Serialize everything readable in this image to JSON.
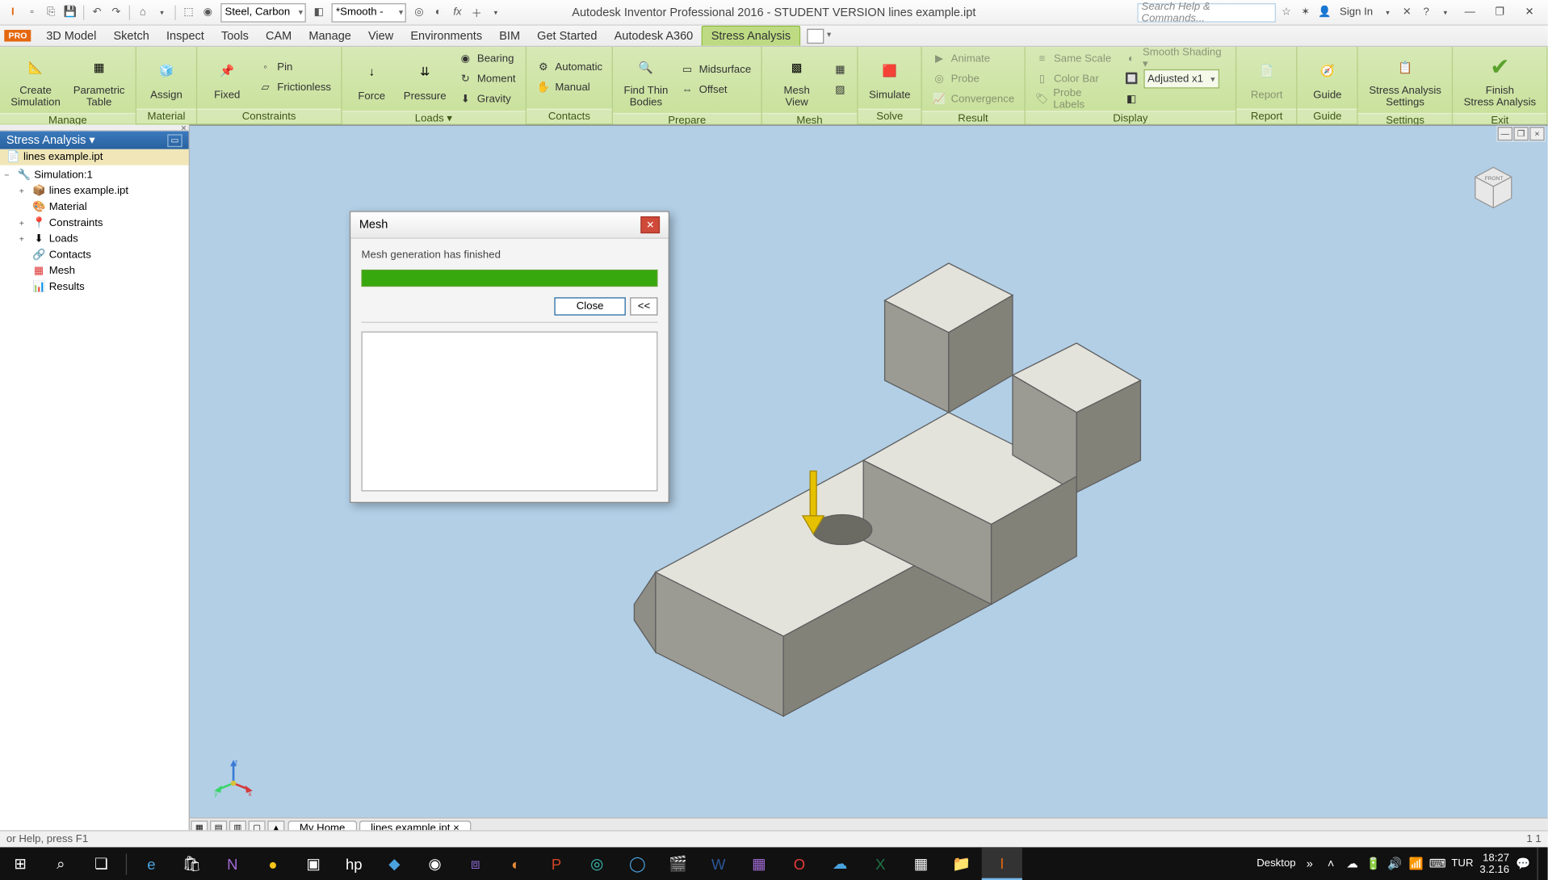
{
  "title": "Autodesk Inventor Professional 2016 - STUDENT VERSION   lines example.ipt",
  "search_placeholder": "Search Help & Commands...",
  "sign_in": "Sign In",
  "material": "Steel, Carbon",
  "appearance": "*Smooth -",
  "pro": "PRO",
  "tabs": [
    "3D Model",
    "Sketch",
    "Inspect",
    "Tools",
    "CAM",
    "Manage",
    "View",
    "Environments",
    "BIM",
    "Get Started",
    "Autodesk A360",
    "Stress Analysis"
  ],
  "ribbon": {
    "manage": {
      "label": "Manage",
      "create": "Create\nSimulation",
      "table": "Parametric\nTable",
      "assign": "Assign"
    },
    "material": {
      "label": "Material"
    },
    "constraints": {
      "label": "Constraints",
      "fixed": "Fixed",
      "pin": "Pin",
      "frictionless": "Frictionless"
    },
    "loads": {
      "label": "Loads ▾",
      "force": "Force",
      "pressure": "Pressure",
      "bearing": "Bearing",
      "moment": "Moment",
      "gravity": "Gravity"
    },
    "contacts": {
      "label": "Contacts",
      "auto": "Automatic",
      "manual": "Manual"
    },
    "prepare": {
      "label": "Prepare",
      "find": "Find Thin\nBodies",
      "mid": "Midsurface",
      "offset": "Offset"
    },
    "mesh": {
      "label": "Mesh",
      "view": "Mesh View"
    },
    "solve": {
      "label": "Solve",
      "sim": "Simulate"
    },
    "result": {
      "label": "Result",
      "animate": "Animate",
      "probe": "Probe",
      "convergence": "Convergence"
    },
    "display": {
      "label": "Display",
      "samescale": "Same Scale",
      "colorbar": "Color Bar",
      "probelabels": "Probe Labels",
      "shading": "Smooth Shading ▾",
      "adjusted": "Adjusted x1"
    },
    "report": {
      "label": "Report",
      "btn": "Report"
    },
    "guide": {
      "label": "Guide",
      "btn": "Guide"
    },
    "settings": {
      "label": "Settings",
      "btn": "Stress Analysis\nSettings"
    },
    "exit": {
      "label": "Exit",
      "btn": "Finish\nStress Analysis"
    }
  },
  "browser": {
    "header": "Stress Analysis ▾",
    "file": "lines example.ipt",
    "sim": "Simulation:1",
    "part": "lines example.ipt",
    "material": "Material",
    "constraints": "Constraints",
    "loads": "Loads",
    "contacts": "Contacts",
    "mesh": "Mesh",
    "results": "Results"
  },
  "dialog": {
    "title": "Mesh",
    "msg": "Mesh generation has finished",
    "close": "Close",
    "expand": "<<"
  },
  "doctabs": {
    "home": "My Home",
    "file": "lines example.ipt ×"
  },
  "status": {
    "help": "or Help, press F1",
    "count": "1   1"
  },
  "tray": {
    "desktop": "Desktop",
    "lang": "TUR",
    "time": "18:27",
    "date": "3.2.16"
  }
}
